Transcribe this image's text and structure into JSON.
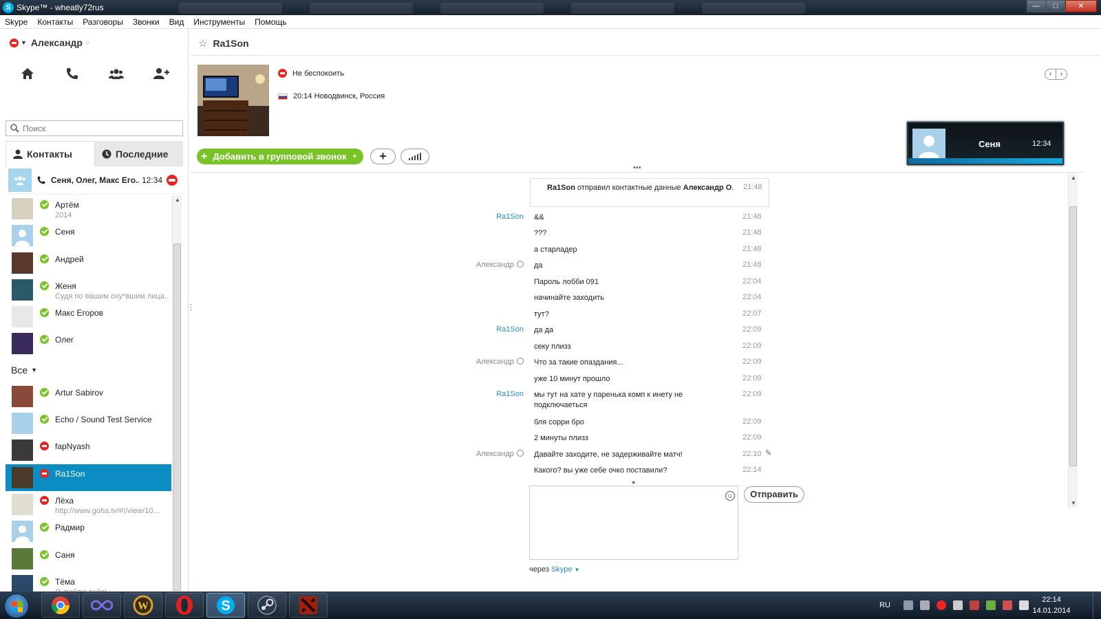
{
  "window": {
    "title": "Skype™ - wheatly72rus",
    "buttons": {
      "minimize": "—",
      "maximize": "□",
      "close": "✕"
    }
  },
  "menu": [
    "Skype",
    "Контакты",
    "Разговоры",
    "Звонки",
    "Вид",
    "Инструменты",
    "Помощь"
  ],
  "profile": {
    "name": "Александр",
    "status": "do-not-disturb"
  },
  "search": {
    "placeholder": "Поиск"
  },
  "tabs": {
    "contacts": "Контакты",
    "recent": "Последние"
  },
  "recent_call": {
    "title": "Сеня, Олег, Макс Его...",
    "time": "12:34"
  },
  "favorites": [
    {
      "name": "Артём",
      "sub": "2014",
      "status": "online",
      "avatar_color": "#d8d0c0"
    },
    {
      "name": "Сеня",
      "sub": "",
      "status": "online",
      "avatar_color": "default"
    },
    {
      "name": "Андрей",
      "sub": "",
      "status": "online",
      "avatar_color": "#5a3a2a"
    },
    {
      "name": "Женя",
      "sub": "Судя по вашим оху*вшим лица...",
      "status": "online",
      "avatar_color": "#2a5a6a"
    },
    {
      "name": "Макс Егоров",
      "sub": "",
      "status": "online",
      "avatar_color": "#e8e8e8"
    },
    {
      "name": "Олег",
      "sub": "",
      "status": "online",
      "avatar_color": "#3a2a5a"
    }
  ],
  "group_label": "Все",
  "contacts": [
    {
      "name": "Artur Sabirov",
      "sub": "",
      "status": "online",
      "avatar_color": "#8a4a3a"
    },
    {
      "name": "Echo / Sound Test Service",
      "sub": "",
      "status": "online",
      "avatar_color": "#a9d2ea"
    },
    {
      "name": "fapNyash",
      "sub": "",
      "status": "dnd",
      "avatar_color": "#3a3a3a"
    },
    {
      "name": "Ra1Son",
      "sub": "",
      "status": "dnd",
      "avatar_color": "#4a3a2a",
      "selected": true
    },
    {
      "name": "Лёха",
      "sub": "http://www.goha.tv/#!/view/10...",
      "status": "dnd",
      "avatar_color": "#e0dcd0"
    },
    {
      "name": "Радмир",
      "sub": "",
      "status": "online",
      "avatar_color": "default"
    },
    {
      "name": "Саня",
      "sub": "",
      "status": "online",
      "avatar_color": "#5a7a3a"
    },
    {
      "name": "Тёма",
      "sub": "Я люблю тебя!",
      "status": "online",
      "avatar_color": "#2a4a6a"
    }
  ],
  "chat": {
    "contact_name": "Ra1Son",
    "status_text": "Не беспокоить",
    "location_text": "20:14 Новодвинск, Россия",
    "add_group_call": "Добавить в групповой звонок",
    "call_card": {
      "name": "Сеня",
      "time": "12:34"
    },
    "system_message": {
      "sender": "Ra1Son",
      "action": "отправил контактные данные",
      "target": "Александр О",
      "suffix": ".",
      "time": "21:48"
    },
    "messages": [
      {
        "sender": "Ra1Son",
        "me": false,
        "text": "&&",
        "time": "21:48"
      },
      {
        "sender": "",
        "me": false,
        "text": "???",
        "time": "21:48"
      },
      {
        "sender": "",
        "me": false,
        "text": "а старладер",
        "time": "21:48"
      },
      {
        "sender": "Александр",
        "me": true,
        "text": "да",
        "time": "21:48"
      },
      {
        "sender": "",
        "me": true,
        "text": "Пароль лобби 091",
        "time": "22:04"
      },
      {
        "sender": "",
        "me": true,
        "text": "начинайте заходить",
        "time": "22:04"
      },
      {
        "sender": "",
        "me": true,
        "text": "тут?",
        "time": "22:07"
      },
      {
        "sender": "Ra1Son",
        "me": false,
        "text": "да да",
        "time": "22:09"
      },
      {
        "sender": "",
        "me": false,
        "text": "секу плизз",
        "time": "22:09"
      },
      {
        "sender": "Александр",
        "me": true,
        "text": "Что за такие опаздания...",
        "time": "22:09"
      },
      {
        "sender": "",
        "me": true,
        "text": "уже 10 минут прошло",
        "time": "22:09"
      },
      {
        "sender": "Ra1Son",
        "me": false,
        "text": "мы тут на хате у паренька комп к инету не подключаеться",
        "time": "22:09"
      },
      {
        "sender": "",
        "me": false,
        "text": "бля сорри бро",
        "time": "22:09"
      },
      {
        "sender": "",
        "me": false,
        "text": "2 минуты плизз",
        "time": "22:09"
      },
      {
        "sender": "Александр",
        "me": true,
        "text": "Давайте заходите, не задерживайте матч!",
        "time": "22:10",
        "edited": true
      },
      {
        "sender": "",
        "me": true,
        "text": "Какого? вы уже себе очко поставили?",
        "time": "22:14"
      }
    ],
    "send_label": "Отправить",
    "via_prefix": "через",
    "via_service": "Skype"
  },
  "taskbar": {
    "apps": [
      "chrome",
      "infinity",
      "warcraft",
      "opera",
      "skype",
      "steam",
      "dota2"
    ],
    "active": "skype",
    "lang": "RU",
    "time": "22:14",
    "date": "14.01.2014"
  },
  "colors": {
    "skype_blue": "#00aff0",
    "selection": "#0b8cc3",
    "online_green": "#78c325",
    "dnd_red": "#e62525",
    "link_blue": "#2a8ad1"
  }
}
